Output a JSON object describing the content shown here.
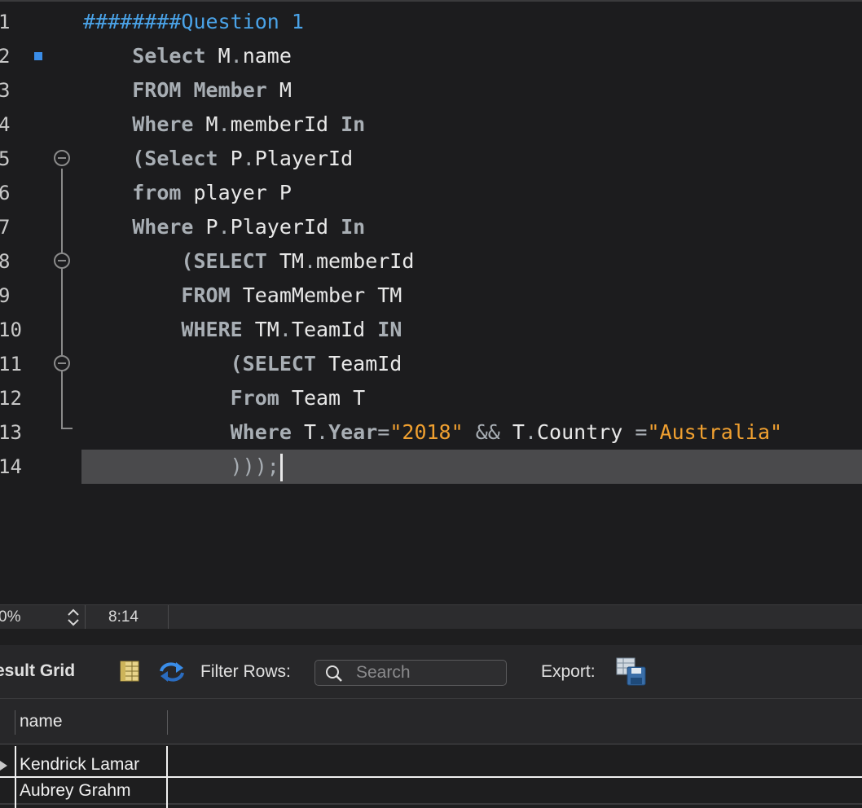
{
  "editor": {
    "lines": [
      {
        "num": "1",
        "segments": [
          {
            "t": "########Question 1",
            "c": "cmt"
          }
        ]
      },
      {
        "num": "2",
        "segments": [
          {
            "t": "    "
          },
          {
            "t": "Select",
            "c": "kw"
          },
          {
            "t": " M"
          },
          {
            "t": ".",
            "c": "op"
          },
          {
            "t": "name"
          }
        ]
      },
      {
        "num": "3",
        "segments": [
          {
            "t": "    "
          },
          {
            "t": "FROM",
            "c": "kw"
          },
          {
            "t": " "
          },
          {
            "t": "Member",
            "c": "kw"
          },
          {
            "t": " M"
          }
        ]
      },
      {
        "num": "4",
        "segments": [
          {
            "t": "    "
          },
          {
            "t": "Where",
            "c": "kw"
          },
          {
            "t": " M"
          },
          {
            "t": ".",
            "c": "op"
          },
          {
            "t": "memberId "
          },
          {
            "t": "In",
            "c": "kw"
          }
        ]
      },
      {
        "num": "5",
        "segments": [
          {
            "t": "    "
          },
          {
            "t": "(Select",
            "c": "kw"
          },
          {
            "t": " P"
          },
          {
            "t": ".",
            "c": "op"
          },
          {
            "t": "PlayerId"
          }
        ]
      },
      {
        "num": "6",
        "segments": [
          {
            "t": "    "
          },
          {
            "t": "from",
            "c": "kw"
          },
          {
            "t": " player P"
          }
        ]
      },
      {
        "num": "7",
        "segments": [
          {
            "t": "    "
          },
          {
            "t": "Where",
            "c": "kw"
          },
          {
            "t": " P"
          },
          {
            "t": ".",
            "c": "op"
          },
          {
            "t": "PlayerId "
          },
          {
            "t": "In",
            "c": "kw"
          }
        ]
      },
      {
        "num": "8",
        "segments": [
          {
            "t": "        "
          },
          {
            "t": "(SELECT",
            "c": "kw"
          },
          {
            "t": " TM"
          },
          {
            "t": ".",
            "c": "op"
          },
          {
            "t": "memberId"
          }
        ]
      },
      {
        "num": "9",
        "segments": [
          {
            "t": "        "
          },
          {
            "t": "FROM",
            "c": "kw"
          },
          {
            "t": " TeamMember TM"
          }
        ]
      },
      {
        "num": "10",
        "segments": [
          {
            "t": "        "
          },
          {
            "t": "WHERE",
            "c": "kw"
          },
          {
            "t": " TM"
          },
          {
            "t": ".",
            "c": "op"
          },
          {
            "t": "TeamId "
          },
          {
            "t": "IN",
            "c": "kw"
          }
        ]
      },
      {
        "num": "11",
        "segments": [
          {
            "t": "            "
          },
          {
            "t": "(SELECT",
            "c": "kw"
          },
          {
            "t": " TeamId"
          }
        ]
      },
      {
        "num": "12",
        "segments": [
          {
            "t": "            "
          },
          {
            "t": "From",
            "c": "kw"
          },
          {
            "t": " Team T"
          }
        ]
      },
      {
        "num": "13",
        "segments": [
          {
            "t": "            "
          },
          {
            "t": "Where",
            "c": "kw"
          },
          {
            "t": " T"
          },
          {
            "t": ".",
            "c": "op"
          },
          {
            "t": "Year",
            "c": "kw"
          },
          {
            "t": "=",
            "c": "op"
          },
          {
            "t": "\"2018\"",
            "c": "str"
          },
          {
            "t": " "
          },
          {
            "t": "&&",
            "c": "op"
          },
          {
            "t": " T"
          },
          {
            "t": ".",
            "c": "op"
          },
          {
            "t": "Country "
          },
          {
            "t": "=",
            "c": "op"
          },
          {
            "t": "\"Australia\"",
            "c": "str"
          }
        ]
      },
      {
        "num": "14",
        "segments": [
          {
            "t": "            "
          },
          {
            "t": ")));",
            "c": "op"
          }
        ]
      }
    ],
    "current_line": 14,
    "breakpoint_line": 2,
    "fold_lines": [
      5,
      8,
      11
    ]
  },
  "statusbar": {
    "zoom": "0%",
    "cursor_position": "8:14"
  },
  "results": {
    "tab_label": "esult Grid",
    "filter_label": "Filter Rows:",
    "search_placeholder": "Search",
    "export_label": "Export:",
    "columns": [
      "name"
    ],
    "rows": [
      {
        "name": "Kendrick Lamar"
      },
      {
        "name": "Aubrey Grahm"
      }
    ]
  },
  "colors": {
    "keyword": "#a8aeb4",
    "string": "#f0a030",
    "comment": "#4aa3e8",
    "current_line_bg": "#4a4a4c",
    "breakpoint": "#3a8de8"
  },
  "icons": {
    "breakpoint": "breakpoint-icon",
    "fold": "fold-collapse-icon",
    "grid": "grid-view-icon",
    "refresh": "refresh-icon",
    "search": "search-icon",
    "export": "export-save-icon",
    "stepper": "stepper-updown-icon",
    "row_pointer": "row-pointer-icon"
  }
}
